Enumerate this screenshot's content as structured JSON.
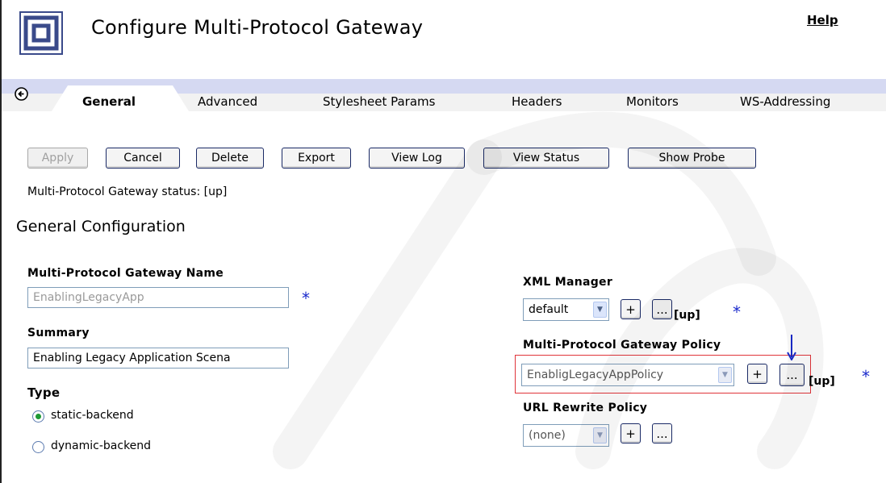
{
  "header": {
    "title": "Configure Multi-Protocol Gateway",
    "help_label": "Help"
  },
  "tabs": [
    {
      "label": "General",
      "active": true
    },
    {
      "label": "Advanced",
      "active": false
    },
    {
      "label": "Stylesheet Params",
      "active": false
    },
    {
      "label": "Headers",
      "active": false
    },
    {
      "label": "Monitors",
      "active": false
    },
    {
      "label": "WS-Addressing",
      "active": false
    }
  ],
  "toolbar": {
    "apply": "Apply",
    "cancel": "Cancel",
    "delete": "Delete",
    "export": "Export",
    "view_log": "View Log",
    "view_status": "View Status",
    "show_probe": "Show Probe"
  },
  "status_line": "Multi-Protocol Gateway status: [up]",
  "section_title": "General Configuration",
  "form": {
    "name_label": "Multi-Protocol Gateway Name",
    "name_value": "EnablingLegacyApp",
    "summary_label": "Summary",
    "summary_value": "Enabling Legacy Application Scena",
    "type_label": "Type",
    "type_options": [
      {
        "label": "static-backend",
        "selected": true
      },
      {
        "label": "dynamic-backend",
        "selected": false
      }
    ],
    "required_marker": "*"
  },
  "right_panel": {
    "xml_manager_label": "XML Manager",
    "xml_manager_value": "default",
    "xml_manager_status": "[up]",
    "policy_label": "Multi-Protocol Gateway Policy",
    "policy_value": "EnabligLegacyAppPolicy",
    "policy_status": "[up]",
    "url_rewrite_label": "URL Rewrite Policy",
    "url_rewrite_value": "(none)",
    "add_label": "+",
    "edit_label": "..."
  },
  "colors": {
    "tabbar": "#d5d9f2",
    "required": "#1a2acc",
    "highlight": "#e0343a",
    "radio_selected": "#1e9a35"
  }
}
